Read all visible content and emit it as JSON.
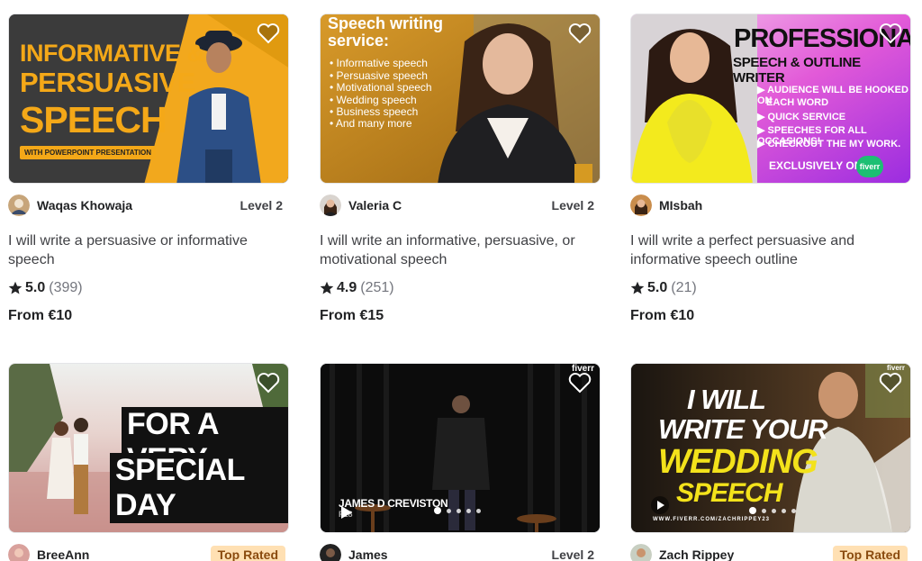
{
  "gigs": [
    {
      "seller": "Waqas Khowaja",
      "badge": "Level 2",
      "title": "I will write a persuasive or informative speech",
      "rating": "5.0",
      "reviews": "(399)",
      "price": "From €10",
      "thumb": {
        "line1": "INFORMATIVE &",
        "line2": "PERSUASIVE",
        "line3": "SPEECH",
        "tag": "WITH POWERPOINT PRESENTATION"
      }
    },
    {
      "seller": "Valeria C",
      "badge": "Level 2",
      "title": "I will write an informative, persuasive, or motivational speech",
      "rating": "4.9",
      "reviews": "(251)",
      "price": "From €15",
      "thumb": {
        "heading1": "Speech writing",
        "heading2": "service:",
        "items": [
          "Informative speech",
          "Persuasive speech",
          "Motivational speech",
          "Wedding speech",
          "Business speech",
          "And many more"
        ]
      }
    },
    {
      "seller": "MIsbah",
      "badge": "",
      "title": "I will write a perfect persuasive and informative speech outline",
      "rating": "5.0",
      "reviews": "(21)",
      "price": "From €10",
      "thumb": {
        "line1": "PROFESSIONAL",
        "line2": "SPEECH & OUTLINE WRITER",
        "items": [
          "AUDIENCE WILL BE HOOKED ON",
          "EACH WORD",
          "QUICK SERVICE",
          "SPEECHES FOR ALL OCCASIONS!",
          "CHECKOUT THE MY WORK."
        ],
        "footer": "EXCLUSIVELY ON",
        "brand": "fiverr"
      }
    },
    {
      "seller": "BreeAnn",
      "badge": "Top Rated",
      "thumb": {
        "line1": "FOR A VERY",
        "line2": "SPECIAL DAY"
      }
    },
    {
      "seller": "James",
      "badge": "Level 2",
      "thumb": {
        "brand": "fiverr",
        "caption": "JAMES D CREVISTON",
        "sub": "F18"
      }
    },
    {
      "seller": "Zach Rippey",
      "badge": "Top Rated",
      "thumb": {
        "line1": "I WILL",
        "line2": "WRITE YOUR",
        "line3": "WEDDING",
        "line4": "SPEECH",
        "brand": "fiverr",
        "url": "WWW.FIVERR.COM/ZACHRIPPEY23"
      }
    }
  ],
  "colors": {
    "top_rated_bg": "#ffe0b3",
    "top_rated_text": "#8a4b0f",
    "star": "#222325"
  },
  "icons": {
    "favorite": "heart-outline-icon",
    "rating": "star-icon",
    "video": "play-icon"
  }
}
